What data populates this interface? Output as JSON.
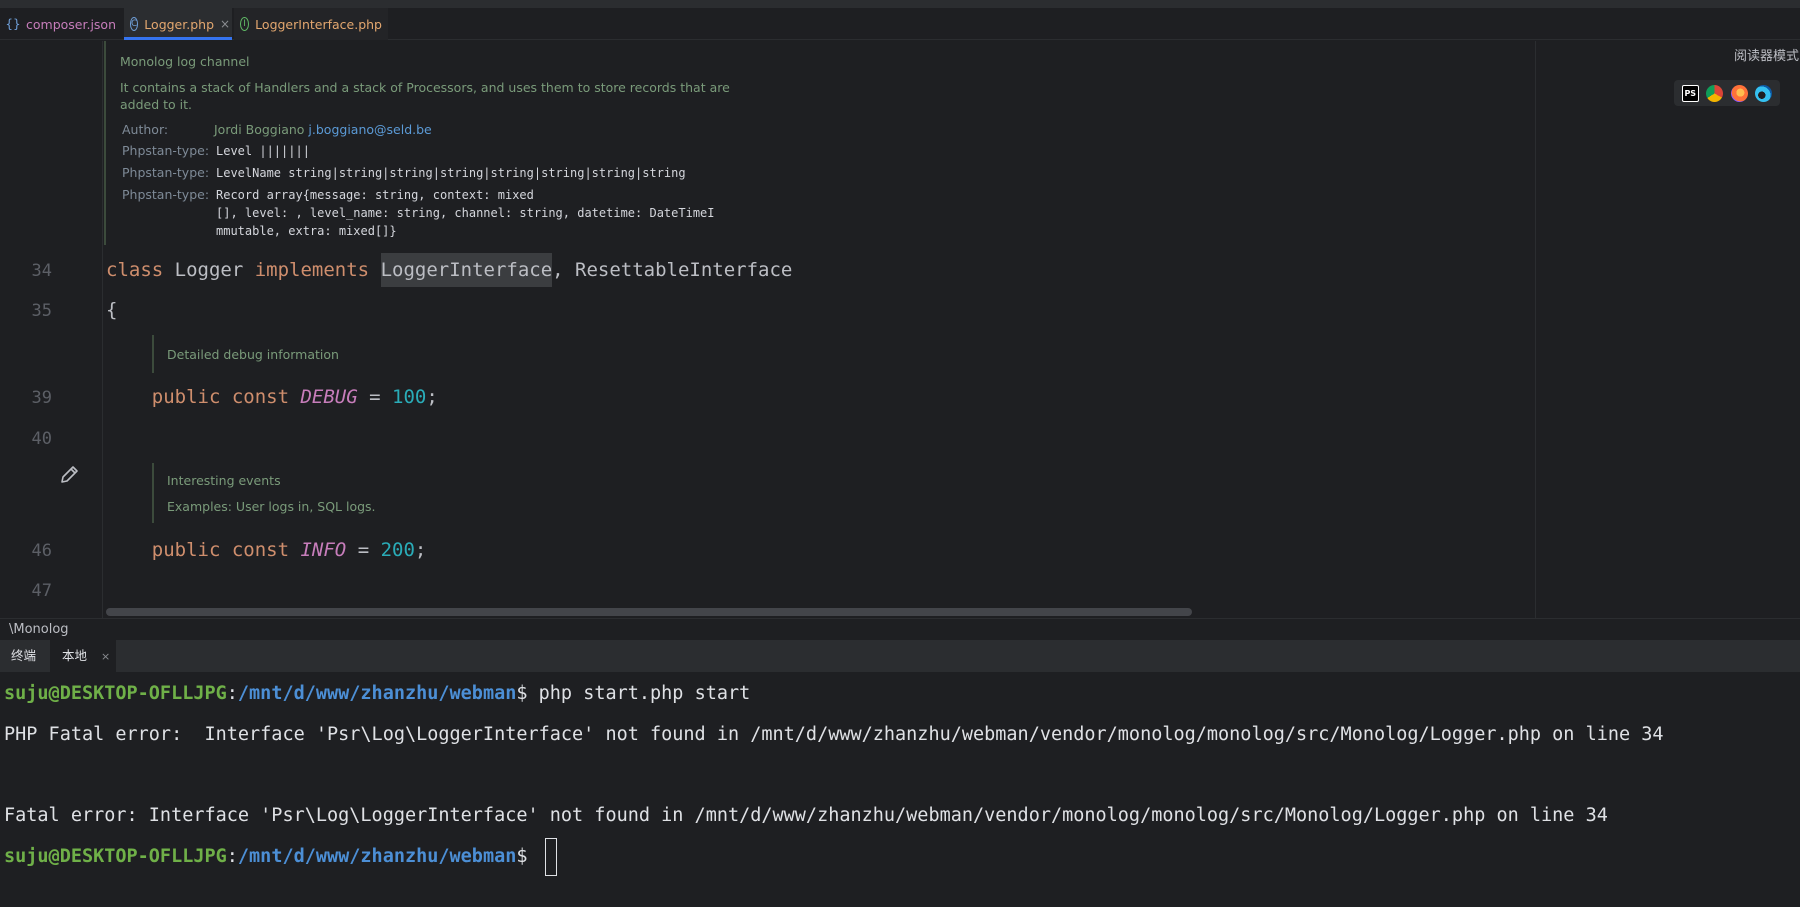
{
  "tabs": [
    {
      "label": "composer.json",
      "icon": "json-braces-icon"
    },
    {
      "label": "Logger.php",
      "icon": "class-icon",
      "close": "×"
    },
    {
      "label": "LoggerInterface.php",
      "icon": "interface-icon"
    }
  ],
  "reader_mode": "阅读器模式",
  "browser_icons": [
    "phpstorm-icon",
    "chrome-icon",
    "firefox-icon",
    "edge-icon"
  ],
  "browser_ps_label": "PS",
  "doc_class": {
    "title": "Monolog log channel",
    "desc_line1": "It contains a stack of Handlers and a stack of Processors, and uses them to store records that are",
    "desc_line2": "added to it.",
    "author_label": "Author:",
    "author_name": "Jordi Boggiano",
    "author_email": "j.boggiano@seld.be",
    "phpstan_label": "Phpstan-type:",
    "type1": "Level |||||||",
    "type2": "LevelName string|string|string|string|string|string|string|string",
    "type3_l1": "Record array{message: string, context: mixed",
    "type3_l2": "[], level: , level_name: string, channel: string, datetime: DateTimeI",
    "type3_l3": "mmutable, extra: mixed[]}"
  },
  "code": {
    "ln34": "34",
    "ln35": "35",
    "ln39": "39",
    "ln40": "40",
    "ln46": "46",
    "ln47": "47",
    "l34_class": "class",
    "l34_name": " Logger ",
    "l34_impl": "implements",
    "l34_sp": " ",
    "l34_iface": "LoggerInterface",
    "l34_rest": ", ResettableInterface",
    "l35": "{",
    "doc_debug": "Detailed debug information",
    "l39_kw": "public const ",
    "l39_const": "DEBUG",
    "l39_eq": " = ",
    "l39_val": "100",
    "l39_end": ";",
    "doc_info1": "Interesting events",
    "doc_info2": "Examples: User logs in, SQL logs.",
    "l46_kw": "public const ",
    "l46_const": "INFO",
    "l46_eq": " = ",
    "l46_val": "200",
    "l46_end": ";"
  },
  "breadcrumb": "\\Monolog",
  "terminal": {
    "tab_title": "终端",
    "tab_local": "本地",
    "tab_close": "×",
    "user": "suju@DESKTOP-OFLLJPG",
    "colon": ":",
    "path": "/mnt/d/www/zhanzhu/webman",
    "prompt": "$ ",
    "command": "php start.php start",
    "err1": "PHP Fatal error:  Interface 'Psr\\Log\\LoggerInterface' not found in /mnt/d/www/zhanzhu/webman/vendor/monolog/monolog/src/Monolog/Logger.php on line 34",
    "err2": "Fatal error: Interface 'Psr\\Log\\LoggerInterface' not found in /mnt/d/www/zhanzhu/webman/vendor/monolog/monolog/src/Monolog/Logger.php on line 34"
  }
}
